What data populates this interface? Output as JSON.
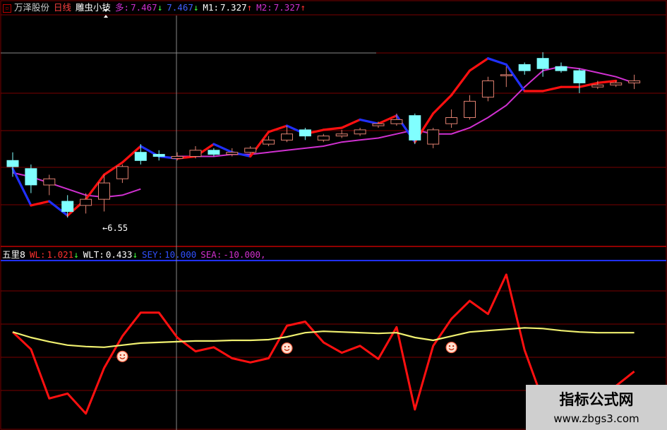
{
  "header_top": {
    "stock_name": "万泽股份",
    "period": "日线",
    "indicator_name": "雕虫小技",
    "duo_label": "多:",
    "duo_value": "7.467",
    "duo_arrow": "↓",
    "kong_value": "7.467",
    "kong_arrow": "↓",
    "m1_label": "M1:",
    "m1_value": "7.327",
    "m1_arrow": "↑",
    "m2_label": "M2:",
    "m2_value": "7.327",
    "m2_arrow": "↑"
  },
  "header_sub": {
    "name": "五里8",
    "wl_label": "WL:",
    "wl_value": "1.021",
    "wl_arrow": "↓",
    "wlt_label": "WLT:",
    "wlt_value": "0.433",
    "wlt_arrow": "↓",
    "sey_label": "SEY:",
    "sey_value": "10.000",
    "sea_label": "SEA:",
    "sea_value": "-10.000,"
  },
  "low_annotation": "←6.55",
  "watermark": {
    "line1": "指标公式网",
    "line2": "www.zbgs3.com"
  },
  "colors": {
    "background": "#000000",
    "grid": "#7a0000",
    "candle_up": "#e08070",
    "candle_down": "#80ffff",
    "bull_line": "#ff1010",
    "bear_line": "#2030ff",
    "ma_line": "#d030d0",
    "wl_line": "#ff1010",
    "wlt_line": "#f0f070",
    "crosshair": "#888888",
    "smiley": "#ffe0d0"
  },
  "chart_data": [
    {
      "type": "candlestick",
      "title": "万泽股份 日线",
      "low_label_value": 6.55,
      "ylim": [
        6.45,
        7.55
      ],
      "candles": [
        {
          "o": 6.84,
          "c": 6.81,
          "h": 6.88,
          "l": 6.76
        },
        {
          "o": 6.8,
          "c": 6.72,
          "h": 6.82,
          "l": 6.68
        },
        {
          "o": 6.72,
          "c": 6.75,
          "h": 6.77,
          "l": 6.67
        },
        {
          "o": 6.64,
          "c": 6.59,
          "h": 6.67,
          "l": 6.56
        },
        {
          "o": 6.62,
          "c": 6.65,
          "h": 6.68,
          "l": 6.58
        },
        {
          "o": 6.65,
          "c": 6.73,
          "h": 6.77,
          "l": 6.59
        },
        {
          "o": 6.75,
          "c": 6.81,
          "h": 6.82,
          "l": 6.73
        },
        {
          "o": 6.88,
          "c": 6.84,
          "h": 6.92,
          "l": 6.82
        },
        {
          "o": 6.87,
          "c": 6.86,
          "h": 6.89,
          "l": 6.84
        },
        {
          "o": 6.85,
          "c": 6.86,
          "h": 6.88,
          "l": 6.84
        },
        {
          "o": 6.86,
          "c": 6.89,
          "h": 6.91,
          "l": 6.85
        },
        {
          "o": 6.89,
          "c": 6.87,
          "h": 6.9,
          "l": 6.86
        },
        {
          "o": 6.87,
          "c": 6.88,
          "h": 6.9,
          "l": 6.86
        },
        {
          "o": 6.88,
          "c": 6.9,
          "h": 6.91,
          "l": 6.87
        },
        {
          "o": 6.92,
          "c": 6.94,
          "h": 6.96,
          "l": 6.91
        },
        {
          "o": 6.94,
          "c": 6.97,
          "h": 7.01,
          "l": 6.93
        },
        {
          "o": 6.99,
          "c": 6.96,
          "h": 7.0,
          "l": 6.94
        },
        {
          "o": 6.94,
          "c": 6.96,
          "h": 6.97,
          "l": 6.93
        },
        {
          "o": 6.96,
          "c": 6.97,
          "h": 6.99,
          "l": 6.95
        },
        {
          "o": 6.97,
          "c": 6.99,
          "h": 7.0,
          "l": 6.96
        },
        {
          "o": 7.01,
          "c": 7.02,
          "h": 7.03,
          "l": 7.0
        },
        {
          "o": 7.02,
          "c": 7.04,
          "h": 7.07,
          "l": 7.01
        },
        {
          "o": 7.06,
          "c": 6.94,
          "h": 7.07,
          "l": 6.92
        },
        {
          "o": 6.92,
          "c": 6.99,
          "h": 7.0,
          "l": 6.9
        },
        {
          "o": 7.02,
          "c": 7.05,
          "h": 7.09,
          "l": 7.0
        },
        {
          "o": 7.05,
          "c": 7.13,
          "h": 7.16,
          "l": 7.04
        },
        {
          "o": 7.15,
          "c": 7.23,
          "h": 7.25,
          "l": 7.13
        },
        {
          "o": 7.26,
          "c": 7.26,
          "h": 7.3,
          "l": 7.2
        },
        {
          "o": 7.31,
          "c": 7.28,
          "h": 7.32,
          "l": 7.26
        },
        {
          "o": 7.34,
          "c": 7.29,
          "h": 7.37,
          "l": 7.25
        },
        {
          "o": 7.3,
          "c": 7.28,
          "h": 7.32,
          "l": 7.27
        },
        {
          "o": 7.28,
          "c": 7.22,
          "h": 7.29,
          "l": 7.17
        },
        {
          "o": 7.2,
          "c": 7.21,
          "h": 7.23,
          "l": 7.19
        },
        {
          "o": 7.21,
          "c": 7.22,
          "h": 7.23,
          "l": 7.2
        },
        {
          "o": 7.22,
          "c": 7.23,
          "h": 7.26,
          "l": 7.19
        }
      ],
      "ma_line": [
        6.78,
        6.76,
        6.73,
        6.7,
        6.67,
        6.66,
        6.67,
        6.7,
        null,
        6.86,
        6.86,
        6.86,
        6.87,
        6.87,
        6.88,
        6.89,
        6.9,
        6.91,
        6.93,
        6.94,
        6.95,
        6.97,
        6.99,
        6.97,
        6.97,
        7.0,
        7.05,
        7.11,
        7.2,
        7.28,
        7.3,
        7.29,
        7.27,
        7.25,
        7.22
      ],
      "bull_bear_line": {
        "points": [
          6.8,
          6.62,
          6.64,
          6.57,
          6.65,
          6.77,
          6.83,
          6.91,
          6.86,
          6.85,
          6.86,
          6.92,
          6.88,
          6.86,
          6.98,
          7.01,
          6.97,
          6.99,
          7.0,
          7.04,
          7.02,
          7.06,
          6.93,
          7.07,
          7.16,
          7.28,
          7.34,
          7.31,
          7.18,
          7.18,
          7.2,
          7.2,
          7.22,
          7.23
        ]
      }
    },
    {
      "type": "line",
      "title": "五里8",
      "ylim": [
        -10,
        10
      ],
      "series": [
        {
          "name": "WL",
          "values": [
            1.0,
            -1.5,
            -8.6,
            -7.9,
            -10.8,
            -4.2,
            0.4,
            3.8,
            3.8,
            0.2,
            -1.8,
            -1.2,
            -2.8,
            -3.4,
            -2.8,
            1.9,
            2.5,
            -0.5,
            -2.0,
            -1.0,
            -2.9,
            1.7,
            -10.2,
            -1.0,
            2.9,
            5.5,
            3.6,
            9.3,
            -1.6,
            -8.9,
            -10.1,
            -9.8,
            -7.5,
            -6.8,
            -4.7
          ]
        },
        {
          "name": "WLT",
          "values": [
            1.0,
            0.2,
            -0.4,
            -0.9,
            -1.1,
            -1.2,
            -0.9,
            -0.6,
            -0.5,
            -0.4,
            -0.3,
            -0.3,
            -0.2,
            -0.2,
            -0.1,
            0.3,
            0.9,
            1.1,
            1.0,
            0.9,
            0.8,
            0.9,
            0.2,
            -0.2,
            0.4,
            1.0,
            1.2,
            1.4,
            1.6,
            1.5,
            1.2,
            1.0,
            0.9,
            0.9,
            0.9
          ]
        }
      ],
      "signals_at_index": [
        6,
        15,
        24
      ]
    }
  ]
}
